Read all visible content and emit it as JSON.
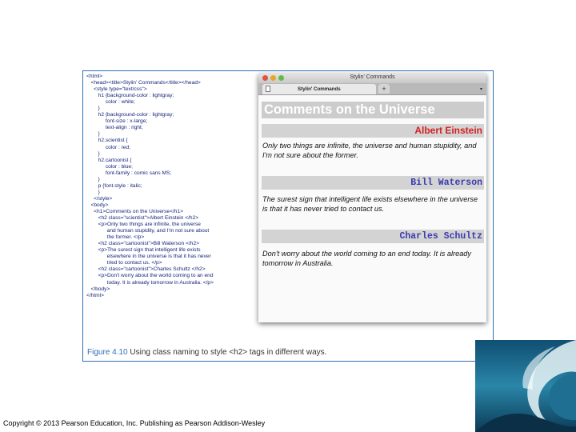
{
  "code_lines": [
    "<html>",
    "   <head><title>Stylin' Commands</title></head>",
    "     <style type=\"text/css\">",
    "        h1 {background-color : lightgray;",
    "             color : white;",
    "        }",
    "        h2 {background-color : lightgray;",
    "             font-size : x-large;",
    "             text-align : right;",
    "        }",
    "        h2.scientist {",
    "             color : red;",
    "        }",
    "        h2.cartoonist {",
    "             color : blue;",
    "             font-family : comic sans MS;",
    "        }",
    "        p {font-style : italic;",
    "        }",
    "     </style>",
    "   <body>",
    "     <h1>Comments on the Universe</h1>",
    "        <h2 class=\"scientist\">Albert Einstein </h2>",
    "        <p>Only two things are infinite, the universe",
    "              and human stupidity, and I'm not sure about",
    "              the former. </p>",
    "        <h2 class=\"cartoonist\">Bill Waterson </h2>",
    "        <p>The surest sign that intelligent life exists",
    "              elsewhere in the universe is that it has never",
    "              tried to contact us. </p>",
    "        <h2 class=\"cartoonist\">Charles Schultz </h2>",
    "        <p>Don't worry about the world coming to an end",
    "              today. It is already tomorrow in Australia. </p>",
    "   </body>",
    "</html>"
  ],
  "browser": {
    "window_title": "Stylin' Commands",
    "tab_title": "Stylin' Commands",
    "new_tab_label": "+",
    "menu_chevron": "▾",
    "page": {
      "h1": "Comments on the Universe",
      "sections": [
        {
          "heading": "Albert Einstein",
          "class": "scientist",
          "text": "Only two things are infinite, the universe and human stupidity, and I'm not sure about the former."
        },
        {
          "heading": "Bill Waterson",
          "class": "cartoonist",
          "text": "The surest sign that intelligent life exists elsewhere in the universe is that it has never tried to contact us."
        },
        {
          "heading": "Charles Schultz",
          "class": "cartoonist",
          "text": "Don't worry about the world coming to an end today. It is already tomorrow in Australia."
        }
      ]
    }
  },
  "caption": {
    "label": "Figure 4.10",
    "text": "Using class naming to style <h2> tags in different ways."
  },
  "copyright": "Copyright © 2013 Pearson Education, Inc. Publishing as Pearson Addison-Wesley",
  "colors": {
    "figure_border": "#2f6fb5",
    "scientist_heading": "#d42020",
    "cartoonist_heading": "#3a3aaf",
    "heading_background": "#d3d3d3",
    "h1_text": "#ffffff"
  }
}
